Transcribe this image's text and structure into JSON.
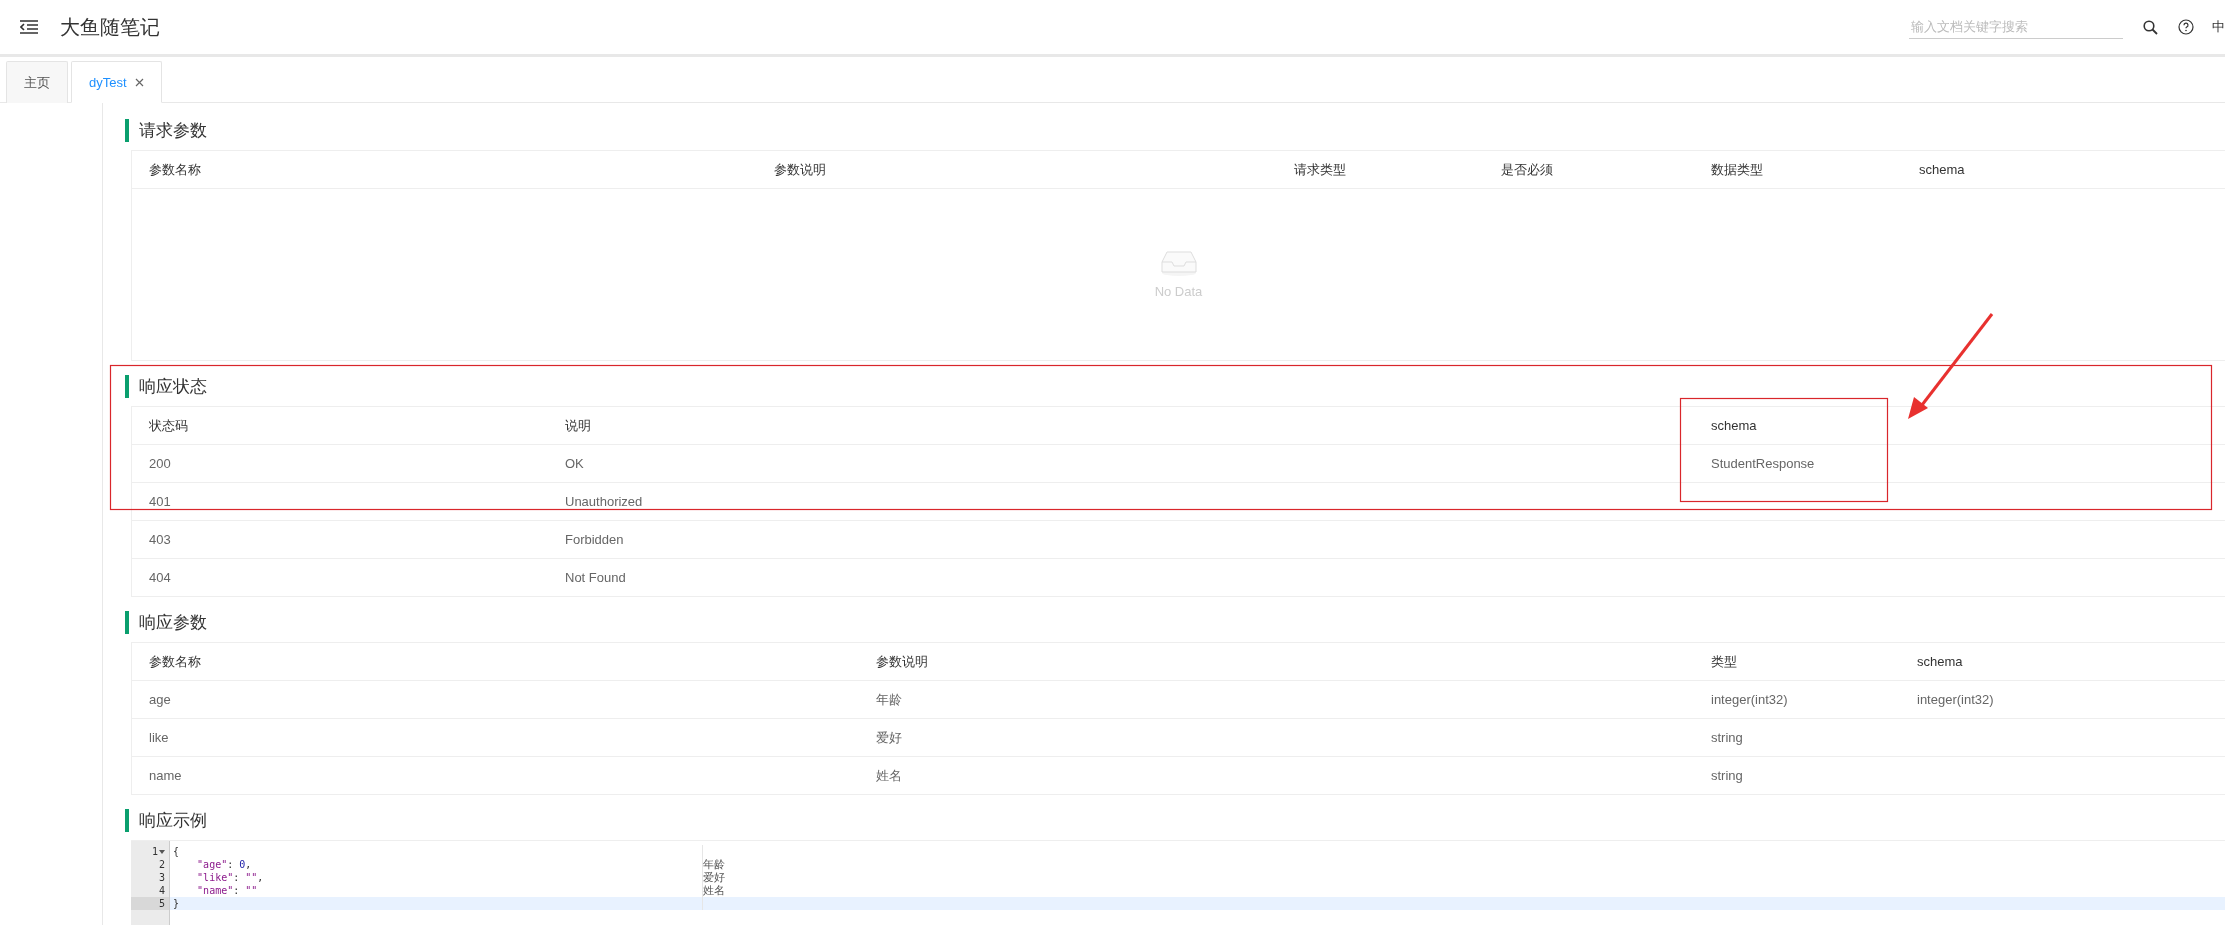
{
  "header": {
    "title": "大鱼随笔记",
    "search_placeholder": "输入文档关键字搜索",
    "language": "中"
  },
  "tabs": [
    {
      "label": "主页",
      "selected": false,
      "closable": false
    },
    {
      "label": "dyTest",
      "selected": true,
      "closable": true
    }
  ],
  "sections": [
    {
      "kind": "table",
      "title": "请求参数",
      "columns": [
        "参数名称",
        "参数说明",
        "请求类型",
        "是否必须",
        "数据类型",
        "schema"
      ],
      "empty_text": "No Data"
    },
    {
      "kind": "table",
      "title": "响应状态",
      "columns": [
        "状态码",
        "说明",
        "schema"
      ],
      "rows": [
        [
          "200",
          "OK",
          "StudentResponse"
        ],
        [
          "401",
          "Unauthorized"
        ],
        [
          "403",
          "Forbidden"
        ],
        [
          "404",
          "Not Found"
        ]
      ]
    },
    {
      "kind": "table",
      "title": "响应参数",
      "columns": [
        "参数名称",
        "参数说明",
        "类型",
        "schema"
      ],
      "rows": [
        [
          "age",
          "年龄",
          "integer(int32)",
          "integer(int32)"
        ],
        [
          "like",
          "爱好",
          "string"
        ],
        [
          "name",
          "姓名",
          "string"
        ]
      ]
    },
    {
      "kind": "code",
      "title": "响应示例",
      "lines": [
        {
          "number": "1",
          "foldable": true,
          "indented": false,
          "selected": false,
          "tokens": [
            {
              "kind": "punct",
              "text": "{"
            }
          ]
        },
        {
          "number": "2",
          "foldable": false,
          "indented": true,
          "selected": false,
          "note": "年龄",
          "tokens": [
            {
              "kind": "key",
              "text": "\"age\""
            },
            {
              "kind": "punct",
              "text": ": "
            },
            {
              "kind": "number",
              "text": "0"
            },
            {
              "kind": "punct",
              "text": ","
            }
          ]
        },
        {
          "number": "3",
          "foldable": false,
          "indented": true,
          "selected": false,
          "note": "爱好",
          "tokens": [
            {
              "kind": "key",
              "text": "\"like\""
            },
            {
              "kind": "punct",
              "text": ": "
            },
            {
              "kind": "key",
              "text": "\"\""
            },
            {
              "kind": "punct",
              "text": ","
            }
          ]
        },
        {
          "number": "4",
          "foldable": false,
          "indented": true,
          "selected": false,
          "note": "姓名",
          "tokens": [
            {
              "kind": "key",
              "text": "\"name\""
            },
            {
              "kind": "punct",
              "text": ": "
            },
            {
              "kind": "key",
              "text": "\"\""
            }
          ]
        },
        {
          "number": "5",
          "foldable": false,
          "indented": false,
          "selected": true,
          "tokens": [
            {
              "kind": "punct",
              "text": "}"
            }
          ]
        }
      ]
    }
  ]
}
